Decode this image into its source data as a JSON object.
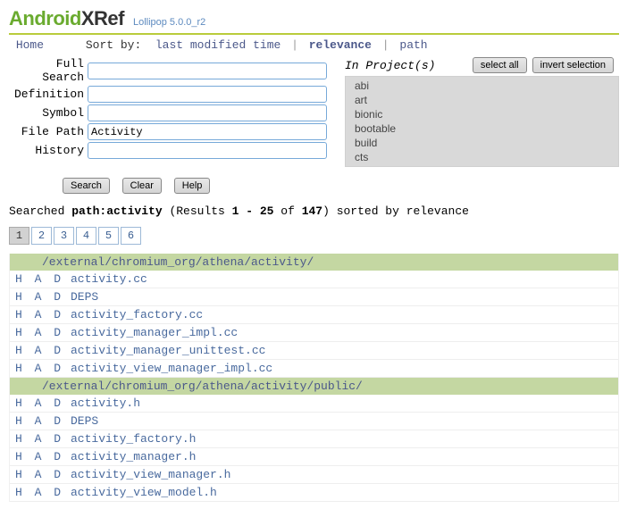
{
  "logo": {
    "left": "Android",
    "right": "XRef"
  },
  "version": "Lollipop 5.0.0_r2",
  "nav": {
    "home": "Home",
    "sortby_label": "Sort by:",
    "sort_options": {
      "lmt": "last modified time",
      "relevance": "relevance",
      "path": "path"
    }
  },
  "form": {
    "labels": {
      "full": "Full Search",
      "def": "Definition",
      "sym": "Symbol",
      "path": "File Path",
      "hist": "History"
    },
    "values": {
      "full": "",
      "def": "",
      "sym": "",
      "path": "Activity",
      "hist": ""
    },
    "buttons": {
      "search": "Search",
      "clear": "Clear",
      "help": "Help"
    }
  },
  "projects": {
    "label": "In Project(s)",
    "select_all": "select all",
    "invert": "invert selection",
    "items": [
      "abi",
      "art",
      "bionic",
      "bootable",
      "build",
      "cts"
    ]
  },
  "results_info": {
    "prefix": "Searched ",
    "query_label": "path:activity",
    "mid1": " (Results ",
    "range": "1 - 25",
    "mid2": " of ",
    "total": "147",
    "suffix": ") sorted by relevance"
  },
  "pager": [
    "1",
    "2",
    "3",
    "4",
    "5",
    "6"
  ],
  "results": {
    "had": "H A D",
    "groups": [
      {
        "dir": "/external/chromium_org/athena/activity/",
        "files": [
          "activity.cc",
          "DEPS",
          "activity_factory.cc",
          "activity_manager_impl.cc",
          "activity_manager_unittest.cc",
          "activity_view_manager_impl.cc"
        ]
      },
      {
        "dir": "/external/chromium_org/athena/activity/public/",
        "files": [
          "activity.h",
          "DEPS",
          "activity_factory.h",
          "activity_manager.h",
          "activity_view_manager.h",
          "activity_view_model.h"
        ]
      }
    ]
  }
}
